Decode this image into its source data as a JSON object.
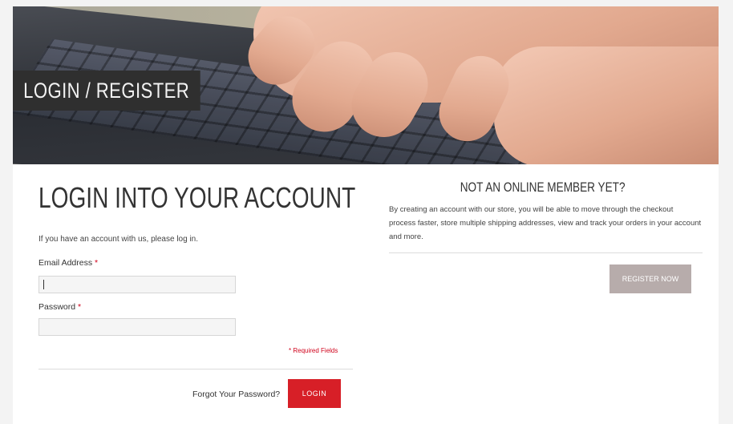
{
  "banner": {
    "title": "LOGIN / REGISTER"
  },
  "login": {
    "heading": "LOGIN INTO YOUR ACCOUNT",
    "intro": "If you have an account with us, please log in.",
    "email_label": "Email Address",
    "email_value": "",
    "password_label": "Password",
    "password_value": "",
    "required_marker": "*",
    "required_note": "* Required Fields",
    "forgot_link": "Forgot Your Password?",
    "login_button": "LOGIN"
  },
  "register": {
    "heading": "NOT AN ONLINE MEMBER YET?",
    "text": "By creating an account with our store, you will be able to move through the checkout process faster, store multiple shipping addresses, view and track your orders in your account and more.",
    "register_button": "REGISTER NOW"
  },
  "colors": {
    "primary_button": "#d71f27",
    "secondary_button": "#b7acab",
    "required": "#d0021b",
    "banner_label_bg": "#2f2f2f"
  }
}
